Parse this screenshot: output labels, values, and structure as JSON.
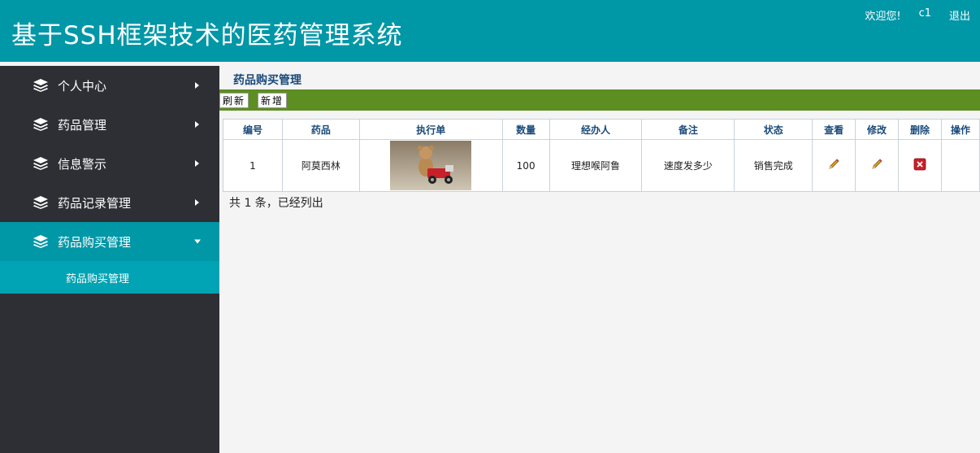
{
  "header": {
    "title": "基于SSH框架技术的医药管理系统",
    "welcome": "欢迎您!",
    "username": "c1",
    "logout": "退出"
  },
  "sidebar": {
    "items": [
      {
        "label": "个人中心"
      },
      {
        "label": "药品管理"
      },
      {
        "label": "信息警示"
      },
      {
        "label": "药品记录管理"
      },
      {
        "label": "药品购买管理"
      }
    ],
    "active_sub": "药品购买管理"
  },
  "main": {
    "page_title": "药品购买管理",
    "refresh_label": "刷新",
    "add_label": "新增",
    "columns": [
      "编号",
      "药品",
      "执行单",
      "数量",
      "经办人",
      "备注",
      "状态",
      "查看",
      "修改",
      "删除",
      "操作"
    ],
    "rows": [
      {
        "id": "1",
        "drug": "阿莫西林",
        "order_image": "teddy-bear-on-red-toy-car",
        "quantity": "100",
        "handler": "理想喉阿鲁",
        "note": "速度发多少",
        "status": "销售完成"
      }
    ],
    "summary": "共 1 条，已经列出"
  },
  "icons": {
    "nav": "stack-icon",
    "view": "pencil-icon",
    "edit": "pencil-icon",
    "delete": "delete-icon"
  },
  "colors": {
    "header": "#0097a7",
    "sidebar": "#2e2f35",
    "submenu": "#00a4b4",
    "toolbar": "#5c8e22"
  }
}
